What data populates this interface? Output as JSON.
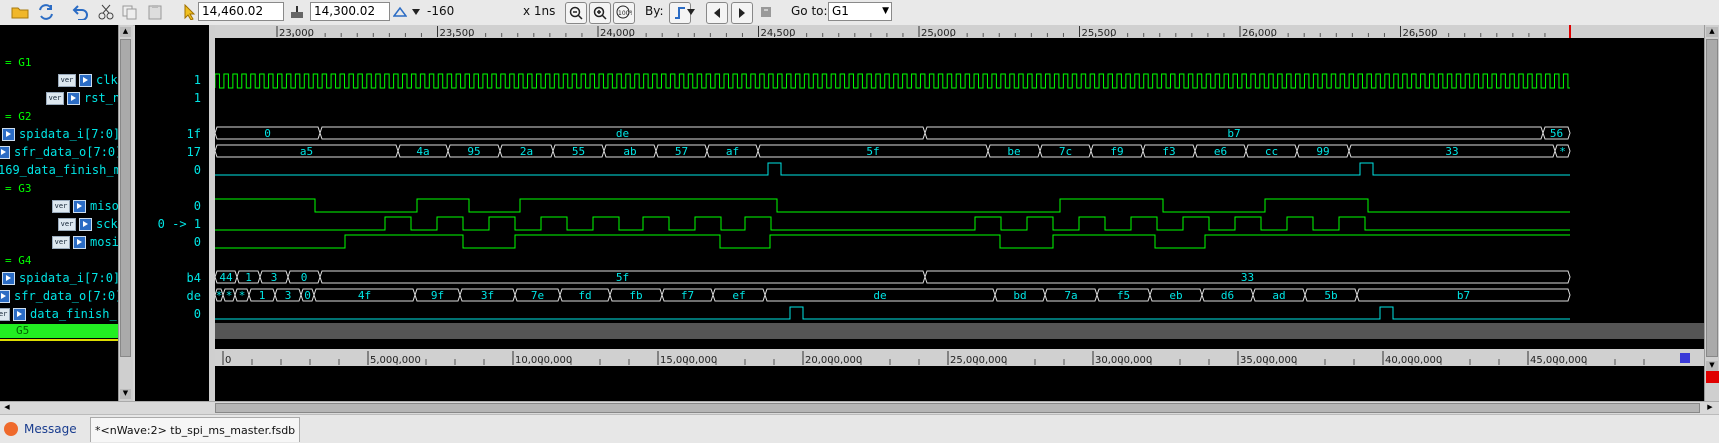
{
  "toolbar": {
    "cursor_time": "14,460.02",
    "marker_time": "14,300.02",
    "delta": "-160",
    "time_unit": "x 1ns",
    "by_label": "By:",
    "goto_label": "Go to:",
    "goto_value": "G1"
  },
  "names": {
    "groups": [
      "= G1",
      "= G2",
      "= G3",
      "= G4",
      "G5"
    ],
    "clk": "clk",
    "rst_n": "rst_n",
    "spidata_i_g2": "spidata_i[7:0]",
    "sfr_data_o_g2": "sfr_data_o[7:0]",
    "finish_g2": "169_data_finish_m",
    "miso": "miso",
    "sck": "sck",
    "mosi": "mosi",
    "spidata_i_g4": "spidata_i[7:0]",
    "sfr_data_o_g4": "sfr_data_o[7:0]",
    "finish_g4": "data_finish_s",
    "ver_badge": "ver"
  },
  "values": {
    "clk": "1",
    "rst_n": "1",
    "spidata_i_g2": "1f",
    "sfr_data_o_g2": "17",
    "finish_g2": "0",
    "miso": "0",
    "sck": "0 -> 1",
    "mosi": "0",
    "spidata_i_g4": "b4",
    "sfr_data_o_g4": "de",
    "finish_g4": "0"
  },
  "top_ruler": {
    "ticks": [
      {
        "t": 23000,
        "label": "23,000"
      },
      {
        "t": 23500,
        "label": "23,500"
      },
      {
        "t": 24000,
        "label": "24,000"
      },
      {
        "t": 24500,
        "label": "24,500"
      },
      {
        "t": 25000,
        "label": "25,000"
      },
      {
        "t": 25500,
        "label": "25,500"
      },
      {
        "t": 26000,
        "label": "26,000"
      },
      {
        "t": 26500,
        "label": "26,500"
      }
    ]
  },
  "bottom_ruler": {
    "ticks": [
      {
        "t": 0,
        "label": "0"
      },
      {
        "t": 5000000,
        "label": "5,000,000"
      },
      {
        "t": 10000000,
        "label": "10,000,000"
      },
      {
        "t": 15000000,
        "label": "15,000,000"
      },
      {
        "t": 20000000,
        "label": "20,000,000"
      },
      {
        "t": 25000000,
        "label": "25,000,000"
      },
      {
        "t": 30000000,
        "label": "30,000,000"
      },
      {
        "t": 35000000,
        "label": "35,000,000"
      },
      {
        "t": 40000000,
        "label": "40,000,000"
      },
      {
        "t": 45000000,
        "label": "45,000,000"
      }
    ]
  },
  "waves": {
    "spidata_i_g2": [
      [
        "0",
        0,
        105
      ],
      [
        "de",
        105,
        710
      ],
      [
        "b7",
        710,
        1328
      ],
      [
        "56",
        1328,
        1355
      ]
    ],
    "sfr_data_o_g2": [
      [
        "a5",
        0,
        183
      ],
      [
        "4a",
        183,
        233
      ],
      [
        "95",
        233,
        285
      ],
      [
        "2a",
        285,
        338
      ],
      [
        "55",
        338,
        389
      ],
      [
        "ab",
        389,
        441
      ],
      [
        "57",
        441,
        492
      ],
      [
        "af",
        492,
        543
      ],
      [
        "5f",
        543,
        773
      ],
      [
        "be",
        773,
        825
      ],
      [
        "7c",
        825,
        876
      ],
      [
        "f9",
        876,
        928
      ],
      [
        "f3",
        928,
        980
      ],
      [
        "e6",
        980,
        1031
      ],
      [
        "cc",
        1031,
        1082
      ],
      [
        "99",
        1082,
        1134
      ],
      [
        "33",
        1134,
        1340
      ],
      [
        "*",
        1340,
        1355
      ]
    ],
    "spidata_i_g4": [
      [
        "44",
        0,
        22
      ],
      [
        "1",
        22,
        45
      ],
      [
        "3",
        45,
        73
      ],
      [
        "0",
        73,
        105
      ],
      [
        "5f",
        105,
        710
      ],
      [
        "33",
        710,
        1355
      ]
    ],
    "sfr_data_o_g4": [
      [
        "*",
        0,
        8
      ],
      [
        "*",
        8,
        20
      ],
      [
        "*",
        20,
        34
      ],
      [
        "1",
        34,
        60
      ],
      [
        "3",
        60,
        86
      ],
      [
        "0",
        86,
        99
      ],
      [
        "4f",
        99,
        200
      ],
      [
        "9f",
        200,
        245
      ],
      [
        "3f",
        245,
        300
      ],
      [
        "7e",
        300,
        345
      ],
      [
        "fd",
        345,
        395
      ],
      [
        "fb",
        395,
        447
      ],
      [
        "f7",
        447,
        498
      ],
      [
        "ef",
        498,
        550
      ],
      [
        "de",
        550,
        780
      ],
      [
        "bd",
        780,
        830
      ],
      [
        "7a",
        830,
        882
      ],
      [
        "f5",
        882,
        935
      ],
      [
        "eb",
        935,
        987
      ],
      [
        "d6",
        987,
        1038
      ],
      [
        "ad",
        1038,
        1090
      ],
      [
        "5b",
        1090,
        1142
      ],
      [
        "b7",
        1142,
        1355
      ]
    ]
  },
  "status": {
    "tab_message": "Message",
    "tab_wave": "*<nWave:2> tb_spi_ms_master.fsdb"
  },
  "colors": {
    "background": "#000000",
    "wave_green": "#00ff00",
    "wave_cyan": "#00e5e5",
    "ruler_bg": "#d0d0d0",
    "group_highlight": "#22ee22"
  }
}
